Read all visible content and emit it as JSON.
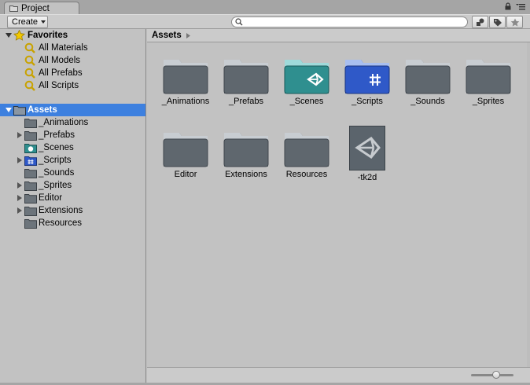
{
  "tab": {
    "title": "Project"
  },
  "toolbar": {
    "create_label": "Create",
    "search_placeholder": "",
    "search_value": ""
  },
  "tree": {
    "favorites_label": "Favorites",
    "favorites": [
      "All Materials",
      "All Models",
      "All Prefabs",
      "All Scripts"
    ],
    "assets_label": "Assets",
    "folders": [
      {
        "label": "_Animations",
        "expandable": false,
        "icon": "folder-icon"
      },
      {
        "label": "_Prefabs",
        "expandable": true,
        "icon": "folder-icon"
      },
      {
        "label": "_Scenes",
        "expandable": false,
        "icon": "scenes-folder-icon"
      },
      {
        "label": "_Scripts",
        "expandable": true,
        "icon": "scripts-folder-icon"
      },
      {
        "label": "_Sounds",
        "expandable": false,
        "icon": "folder-icon"
      },
      {
        "label": "_Sprites",
        "expandable": true,
        "icon": "folder-icon"
      },
      {
        "label": "Editor",
        "expandable": true,
        "icon": "folder-icon"
      },
      {
        "label": "Extensions",
        "expandable": true,
        "icon": "folder-icon"
      },
      {
        "label": "Resources",
        "expandable": false,
        "icon": "folder-icon"
      }
    ]
  },
  "breadcrumb": {
    "label": "Assets"
  },
  "grid": {
    "items": [
      {
        "label": "_Animations",
        "kind": "folder"
      },
      {
        "label": "_Prefabs",
        "kind": "folder"
      },
      {
        "label": "_Scenes",
        "kind": "scenes-folder"
      },
      {
        "label": "_Scripts",
        "kind": "scripts-folder"
      },
      {
        "label": "_Sounds",
        "kind": "folder"
      },
      {
        "label": "_Sprites",
        "kind": "folder"
      },
      {
        "label": "Editor",
        "kind": "folder"
      },
      {
        "label": "Extensions",
        "kind": "folder"
      },
      {
        "label": "Resources",
        "kind": "folder"
      },
      {
        "label": "-tk2d",
        "kind": "unity-scene"
      }
    ]
  },
  "colors": {
    "selection": "#3d80df",
    "folder": "#5f676e",
    "scenes_folder": "#2f8f8f",
    "scripts_folder": "#2f59c8"
  }
}
